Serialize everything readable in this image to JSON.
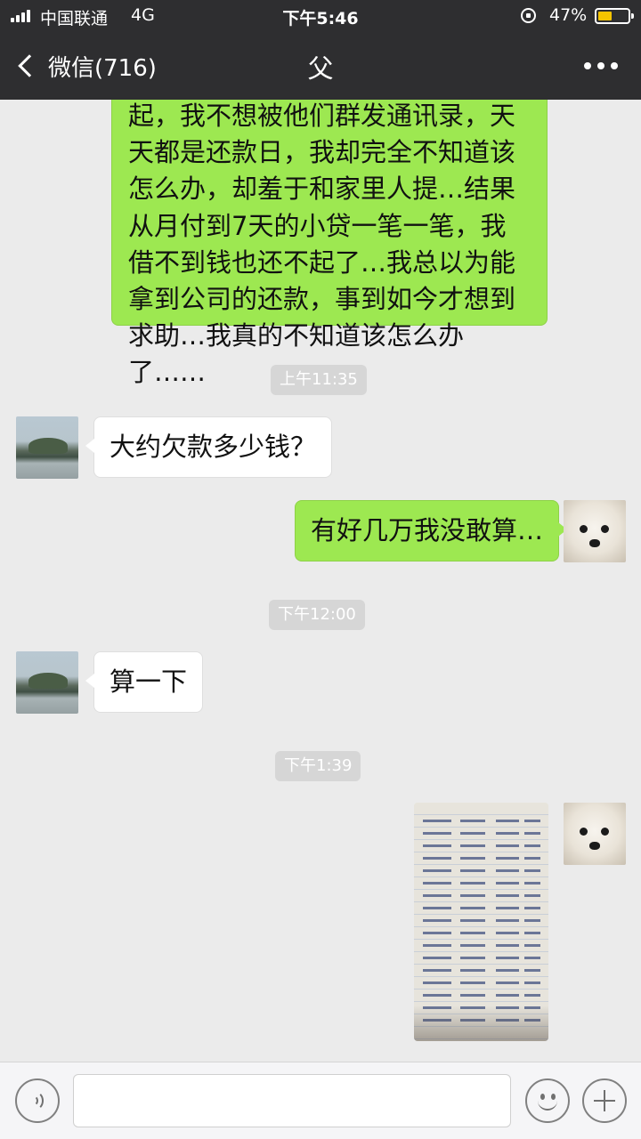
{
  "status_bar": {
    "carrier": "中国联通",
    "network": "4G",
    "time": "下午5:46",
    "battery": "47%",
    "battery_level": 0.47
  },
  "nav": {
    "back_label": "微信(716)",
    "title": "父"
  },
  "messages": [
    {
      "side": "right",
      "type": "text",
      "text": "起，我不想被他们群发通讯录，天天都是还款日，我却完全不知道该怎么办，却羞于和家里人提…结果从月付到7天的小贷一笔一笔，我借不到钱也还不起了…我总以为能拿到公司的还款，事到如今才想到求助…我真的不知道该怎么办了……"
    },
    {
      "type": "timestamp",
      "text": "上午11:35"
    },
    {
      "side": "left",
      "type": "text",
      "text": "大约欠款多少钱？"
    },
    {
      "side": "right",
      "type": "text",
      "text": "有好几万我没敢算…"
    },
    {
      "type": "timestamp",
      "text": "下午12:00"
    },
    {
      "side": "left",
      "type": "text",
      "text": "算一下"
    },
    {
      "type": "timestamp",
      "text": "下午1:39"
    },
    {
      "side": "right",
      "type": "image",
      "text": ""
    }
  ],
  "input": {
    "value": "",
    "placeholder": ""
  },
  "colors": {
    "topbar": "#2e2e30",
    "background": "#ebebeb",
    "sent_bubble": "#9de851",
    "received_bubble": "#ffffff",
    "timestamp_bg": "#d6d6d6",
    "battery_fill": "#f5c400"
  },
  "icons": {
    "back": "chevron-left-icon",
    "more": "more-dots-icon",
    "voice": "voice-icon",
    "emoji": "emoji-icon",
    "add": "plus-icon"
  }
}
